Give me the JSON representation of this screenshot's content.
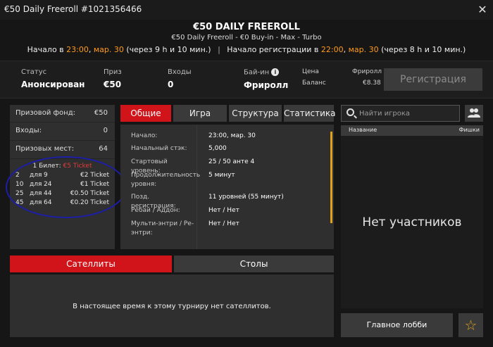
{
  "window": {
    "title": "€50 Daily Freeroll #1021356466",
    "close_glyph": "✕"
  },
  "header": {
    "title": "€50 DAILY FREEROLL",
    "subtitle": "€50 Daily Freeroll - €0 Buy-in - Max - Turbo",
    "start_label": "Начало в ",
    "start_time": "23:00",
    "start_date": "мар. 30",
    "start_rel": " (через 9 h и 10 мин.)",
    "separator": "|",
    "reg_label": "Начало регистрации в ",
    "reg_time": "22:00",
    "reg_date": "мар. 30",
    "reg_rel": " (через 8 h и 10 мин.)"
  },
  "info": {
    "status_label": "Статус",
    "status_value": "Анонсирован",
    "prize_label": "Приз",
    "prize_value": "€50",
    "entries_label": "Входы",
    "entries_value": "0",
    "buyin_label": "Бай-ин",
    "buyin_value": "Фриролл",
    "info_glyph": "i",
    "price_label": "Цена",
    "price_value": "Фриролл",
    "balance_label": "Баланс",
    "balance_value": "€8.38",
    "register_button": "Регистрация"
  },
  "left": {
    "prize_pool_label": "Призовой фонд:",
    "prize_pool_value": "€50",
    "entries_label": "Входы:",
    "entries_value": "0",
    "paid_label": "Призовых мест:",
    "paid_value": "64",
    "ticket_prefix": "1 Билет: ",
    "ticket_value": "€5 Ticket",
    "payouts": [
      {
        "from": "2",
        "word": "для",
        "to": "9",
        "prize": "€2 Ticket"
      },
      {
        "from": "10",
        "word": "для",
        "to": "24",
        "prize": "€1 Ticket"
      },
      {
        "from": "25",
        "word": "для",
        "to": "44",
        "prize": "€0.50 Ticket"
      },
      {
        "from": "45",
        "word": "для",
        "to": "64",
        "prize": "€0.20 Ticket"
      }
    ]
  },
  "tabs": [
    "Общие",
    "Игра",
    "Структура",
    "Статистика"
  ],
  "details": [
    {
      "k": "Начало:",
      "v": "23:00, мар. 30"
    },
    {
      "k": "Начальный стэк:",
      "v": "5,000"
    },
    {
      "k": "Стартовый уровень:",
      "v": "25 / 50 анте 4"
    },
    {
      "k": "Продолжительность уровня:",
      "v": "5 минут"
    },
    {
      "k": "Позд. регистрация:",
      "v": "11 уровней (55 минут)"
    },
    {
      "k": "Ребаи / Аддон:",
      "v": "Нет / Нет"
    },
    {
      "k": "Мульти-энтри / Ре-энтри:",
      "v": "Нет / Нет"
    }
  ],
  "players": {
    "search_placeholder": "Найти игрока",
    "col_name": "Название",
    "col_chips": "Фишки",
    "empty": "Нет участников",
    "lobby_button": "Главное лобби",
    "star_glyph": "☆"
  },
  "bottom": {
    "tab_satellites": "Сателлиты",
    "tab_tables": "Столы",
    "message": "В настоящее время к этому турниру нет сателлитов."
  },
  "colors": {
    "accent_red": "#d0141a",
    "accent_orange": "#ff9a1e",
    "annotation_blue": "#1d1ea8"
  }
}
